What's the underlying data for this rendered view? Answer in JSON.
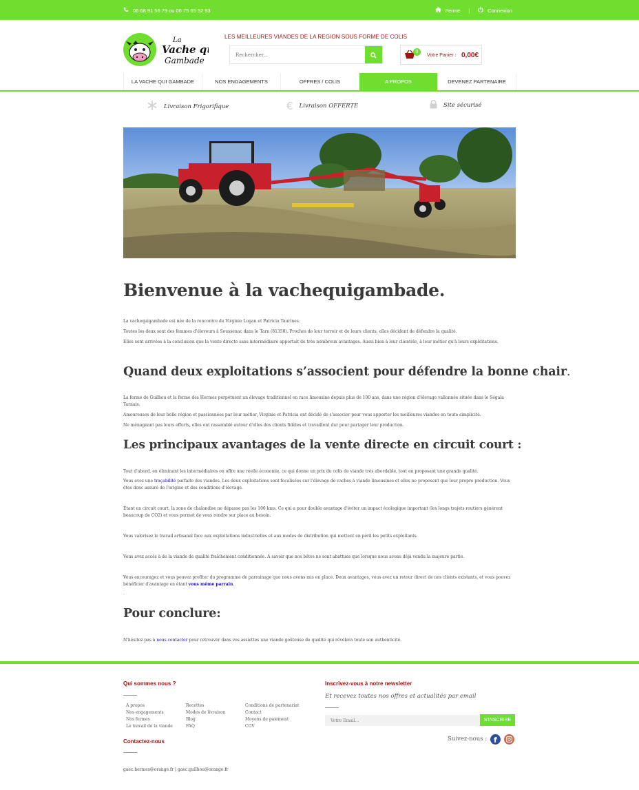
{
  "topbar": {
    "phone": "06 68 91 56 79 ou 06 75 65 52 93",
    "ferme": "Ferme",
    "connexion": "Connexion"
  },
  "header": {
    "logo_text": [
      "La",
      "Vache qui",
      "Gambade"
    ],
    "tagline": "LES MEILLEURES VIANDES DE LA REGION SOUS FORME DE COLIS",
    "search_placeholder": "Rechercher...",
    "cart_count": "0",
    "cart_label": "Votre Panier :",
    "cart_amount": "0,00€"
  },
  "nav": [
    {
      "label": "LA VACHE QUI GAMBADE",
      "active": false
    },
    {
      "label": "NOS ENGAGEMENTS",
      "active": false
    },
    {
      "label": "OFFRES / COLIS",
      "active": false
    },
    {
      "label": "A PROPOS",
      "active": true
    },
    {
      "label": "DEVENEZ PARTENAIRE",
      "active": false
    }
  ],
  "features": {
    "frigo": "Livraison Frigorifique",
    "offerte": "Livraison OFFERTE",
    "securise": "Site sécurisé"
  },
  "colors": {
    "accent": "#6fde2f",
    "brand": "#9b1410",
    "link": "#1a0db5"
  },
  "content": {
    "title": "Bienvenue à la vachequigambade.",
    "intro": [
      "La vachequigambade est née de la rencontre de Virginie Lugan et Patricia Taurines.",
      "Toutes les deux sont des femmes d'éleveurs à Soussenac dans le Tarn (81350). Proches de leur terroir et de leurs clients, elles décident de défendre la qualité.",
      "Elles sont arrivées à la conclusion que la vente directe sans intermédiaire apportait de très nombreux avantages. Aussi bien à leur clientèle, à leur métier qu'à leurs exploitations."
    ],
    "h2_1": "Quand deux exploitations s’associent pour défendre la bonne chair",
    "h2_1_dot": ".",
    "sec1": [
      "La ferme de Guilhou et la ferme des Hermes perpétuent un élevage traditionnel en race limousine depuis plus de 100 ans, dans une région d'élevage vallonnée située dans le Ségala Tarnais.",
      "Amoureuses de leur belle région et passionnées par leur métier, Virginie et Patricia ont décidé de s'associer pour vous apporter les meilleures viandes en toute simplicité.",
      "Ne ménageant pas leurs efforts, elles ont rassemblé autour d'elles des clients fidèles et travaillent dur pour partager leur production."
    ],
    "h2_2": "Les principaux avantages de la vente directe en circuit court :",
    "sec2_p1": "Tout d'abord, en éliminant les intermédiaires on offre une réelle économie, ce qui donne un prix du colis de viande très abordable, tout en proposant une grande qualité.",
    "sec2_p2_a": "Vous avez une ",
    "sec2_p2_link": "traçabilité",
    "sec2_p2_b": " parfaite des viandes. Les deux exploitations sont focalisées sur l'élevage de vaches à viande limousines et elles ne proposent que leur propre production. Vous êtes donc assuré de l'origine et des conditions d'élevage.",
    "sec2_p3": "Étant en circuit court, la zone de chalandise ne dépasse pas les 100 kms. Ce qui a pour double avantage d'éviter un impact écologique important (les longs trajets routiers  génèrent beaucoup de CO2) et vous permet de vous rendre sur place au besoin.",
    "sec2_p4": "Vous valorisez le travail artisanal face aux exploitations industrielles et aux modes de distribution qui mettent en péril les petits exploitants.",
    "sec2_p5": "Vous avez accès à de la viande de qualité fraîchement conditionnée. A savoir que nos bêtes ne sont abattues que lorsque nous avons déjà vendu la majeure partie.",
    "sec2_p6_a": "Vous encouragez et vous pouvez profiter du programme de parrainage que nous avons mis en place. Deux avantages, vous avez un retour direct de nos clients existants, et vous pouvez bénéficier d'avantage en étant ",
    "sec2_p6_link": "vous même parrain",
    "sec2_p6_b": ".",
    "sec2_dot": ".",
    "h2_3": "Pour conclure:",
    "concl_a": "N'hésitez pas à ",
    "concl_link": "nous contacter",
    "concl_b": " pour retrouver dans vos assiettes une viande goûteuse de qualité qui révèlera toute son authenticité."
  },
  "footer": {
    "about_title": "Qui sommes nous ?",
    "links_col1": [
      "A propos",
      "Nos engagements",
      "Nos fermes",
      "Le travail de la viande"
    ],
    "links_col2": [
      "Recettes",
      "Modes de livraison",
      "Blog",
      "FAQ"
    ],
    "links_col3": [
      "Conditions de partenariat",
      "Contact",
      "Moyens de paiement",
      "CGV"
    ],
    "contact_title": "Contactez-nous",
    "emails": "gaec.hermes@orange.fr | gaec.guilhou@orange.fr",
    "newsletter_title": "Inscrivez-vous à notre newsletter",
    "newsletter_sub": "Et recevez toutes nos offres et actualités par email",
    "email_placeholder": "Votre Email...",
    "subscribe": "S'INSCRIRE",
    "follow": "Suivez-nous :"
  }
}
